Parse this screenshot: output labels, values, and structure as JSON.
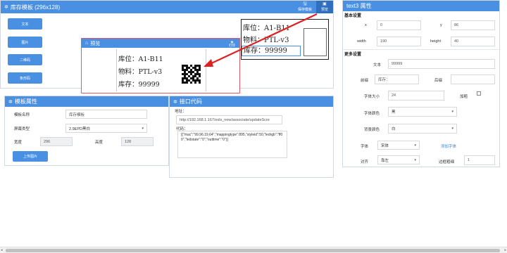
{
  "template_panel": {
    "title": "库存模板 (296x128)",
    "save_label": "保存模板",
    "preview_label": "预览",
    "tools": [
      "文本",
      "图片",
      "二维码",
      "条形码"
    ],
    "preview_title": "预览",
    "print_label": "打印"
  },
  "label": {
    "line1": "库位：A1-B11",
    "line2": "物料：PTL-v3",
    "line3": "库存：99999"
  },
  "preview_label": {
    "line1": "库位：A1-B11",
    "line2": "物料：PTL-v3",
    "line3": "库存：99999"
  },
  "props_panel": {
    "title": "模板属性",
    "name_label": "模板名称",
    "name_value": "库存模板",
    "screen_label": "屏幕类型",
    "screen_value": "2.9EPD黑白",
    "width_label": "宽度",
    "width_value": "296",
    "height_label": "高度",
    "height_value": "128",
    "upload_label": "上传图片"
  },
  "api_panel": {
    "title": "接口代码",
    "url_label": "地址：",
    "url_value": "http://192.168.1.167/esls_new/associate/updateScre",
    "code_label": "代码：",
    "code_value": "[{\"mac\":\"99.96.19.64\",\"mappingtype\":895,\"styleid\":50,\"ledrgb\":\"ff00\",\"ledstate\":\"0\",\"outtime\":\"0\"}]"
  },
  "attr_panel": {
    "title": "text3 属性",
    "basic_title": "基本设置",
    "x_label": "x",
    "x_value": "0",
    "y_label": "y",
    "y_value": "86",
    "width_label": "width",
    "width_value": "190",
    "height_label": "height",
    "height_value": "40",
    "more_title": "更多设置",
    "text_label": "文本",
    "text_value": "99999",
    "prefix_label": "前缀",
    "prefix_value": "库存：",
    "suffix_label": "后缀",
    "suffix_value": "",
    "fontsize_label": "字体大小",
    "fontsize_value": "24",
    "bold_label": "加粗",
    "fontcolor_label": "字体颜色",
    "fontcolor_value": "黑",
    "bgcolor_label": "背景颜色",
    "bgcolor_value": "白",
    "font_label": "字体",
    "font_value": "宋体",
    "add_font_label": "添加字体",
    "align_label": "对齐",
    "align_value": "靠左",
    "border_label": "边框粗细",
    "border_value": "1"
  },
  "colors": {
    "accent": "#4a90e2",
    "preview_border": "#e05a6a",
    "arrow": "#e02020"
  }
}
